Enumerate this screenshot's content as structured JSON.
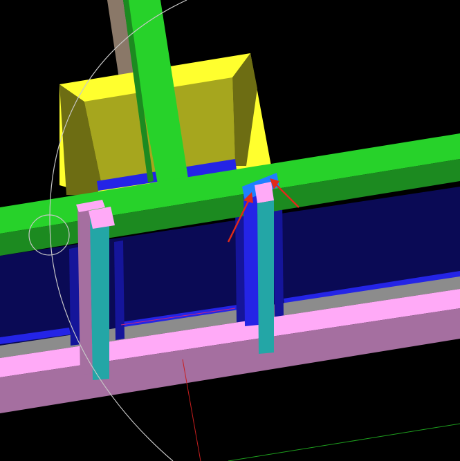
{
  "viewport": {
    "background": "#000000"
  },
  "colors": {
    "beam_green_top": "#27d22a",
    "beam_green_side": "#1c8a20",
    "column_green": "#27d22a",
    "column_green_shadow": "#1c8a20",
    "frame_yellow": "#ffff2e",
    "frame_yellow_inner": "#a6a61e",
    "frame_yellow_dark": "#6d6d13",
    "wall_navy": "#0a0a55",
    "wall_blue_trim": "#2424e6",
    "wall_blue_dark": "#15159a",
    "floor_gray": "#8c8c8c",
    "slab_pink_top": "#ffaaf7",
    "slab_pink_side": "#a56fa0",
    "post_teal": "#23a6a6",
    "post_pink": "#ffaaf7",
    "post_pink_side": "#a56fa0",
    "cap_light_blue": "#1f7fff",
    "brown_rod": "#8a7868",
    "arrow_red": "#e02a1a",
    "guide_white": "#c8c8c8",
    "axis_red": "#c81e1e",
    "axis_green": "#1ea01e",
    "axis_magenta": "#c8287a"
  },
  "icons": {
    "orbit_ring": "orbit-circle-icon",
    "pivot_marker": "pivot-circle-icon",
    "annotation_arrow": "red-arrow-icon"
  }
}
